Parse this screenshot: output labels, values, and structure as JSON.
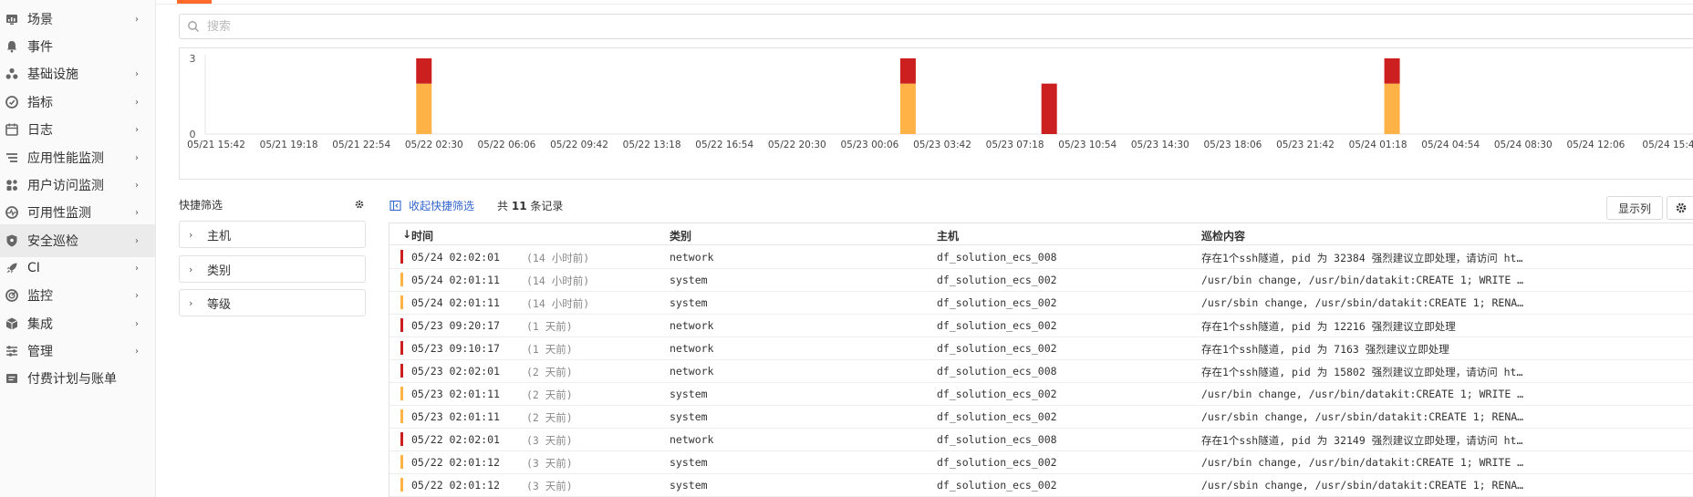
{
  "sidebar": {
    "items": [
      {
        "label": "场景",
        "icon": "dashboard-icon",
        "chevron": true
      },
      {
        "label": "事件",
        "icon": "bell-icon",
        "chevron": false
      },
      {
        "label": "基础设施",
        "icon": "infrastructure-icon",
        "chevron": true
      },
      {
        "label": "指标",
        "icon": "metrics-icon",
        "chevron": true
      },
      {
        "label": "日志",
        "icon": "log-icon",
        "chevron": true
      },
      {
        "label": "应用性能监测",
        "icon": "apm-icon",
        "chevron": true
      },
      {
        "label": "用户访问监测",
        "icon": "rum-icon",
        "chevron": true
      },
      {
        "label": "可用性监测",
        "icon": "availability-icon",
        "chevron": true
      },
      {
        "label": "安全巡检",
        "icon": "shield-icon",
        "chevron": true,
        "active": true
      },
      {
        "label": "CI",
        "icon": "rocket-icon",
        "chevron": true
      },
      {
        "label": "监控",
        "icon": "monitor-icon",
        "chevron": true
      },
      {
        "label": "集成",
        "icon": "integration-icon",
        "chevron": true
      },
      {
        "label": "管理",
        "icon": "settings-sliders-icon",
        "chevron": true
      },
      {
        "label": "付费计划与账单",
        "icon": "billing-icon",
        "chevron": false
      }
    ]
  },
  "search": {
    "placeholder": "搜索"
  },
  "colors": {
    "critical": "#cc1f1f",
    "warning": "#ffb347",
    "accent": "#ff6a2a",
    "link": "#3366cc"
  },
  "chart_data": {
    "type": "bar",
    "stacked": true,
    "ylim": [
      0,
      3
    ],
    "y_ticks": [
      "3",
      "0"
    ],
    "x_labels": [
      "05/21 15:42",
      "05/21 19:18",
      "05/21 22:54",
      "05/22 02:30",
      "05/22 06:06",
      "05/22 09:42",
      "05/22 13:18",
      "05/22 16:54",
      "05/22 20:30",
      "05/23 00:06",
      "05/23 03:42",
      "05/23 07:18",
      "05/23 10:54",
      "05/23 14:30",
      "05/23 18:06",
      "05/23 21:42",
      "05/24 01:18",
      "05/24 04:54",
      "05/24 08:30",
      "05/24 12:06",
      "05/24 15:4"
    ],
    "bars": [
      {
        "x": "05/22 02:00",
        "warning": 2,
        "critical": 1
      },
      {
        "x": "05/23 02:00",
        "warning": 2,
        "critical": 1
      },
      {
        "x": "05/23 09:00",
        "warning": 0,
        "critical": 2
      },
      {
        "x": "05/24 02:00",
        "warning": 2,
        "critical": 1
      }
    ]
  },
  "quick_filter": {
    "title": "快捷筛选",
    "items": [
      "主机",
      "类别",
      "等级"
    ]
  },
  "toolbar": {
    "collapse_label": "收起快捷筛选",
    "count_prefix": "共",
    "count": "11",
    "count_suffix": "条记录",
    "columns_label": "显示列"
  },
  "table": {
    "headers": [
      "时间",
      "类别",
      "主机",
      "巡检内容"
    ],
    "sort_indicator": "↓",
    "rows": [
      {
        "level": "critical",
        "time": "05/24 02:02:01",
        "rel": "(14 小时前)",
        "category": "network",
        "host": "df_solution_ecs_008",
        "content": "存在1个ssh隧道, pid 为 32384 强烈建议立即处理，请访问 ht…"
      },
      {
        "level": "warning",
        "time": "05/24 02:01:11",
        "rel": "(14 小时前)",
        "category": "system",
        "host": "df_solution_ecs_002",
        "content": "/usr/bin change, /usr/bin/datakit:CREATE 1; WRITE …"
      },
      {
        "level": "warning",
        "time": "05/24 02:01:11",
        "rel": "(14 小时前)",
        "category": "system",
        "host": "df_solution_ecs_002",
        "content": "/usr/sbin change, /usr/sbin/datakit:CREATE 1; RENA…"
      },
      {
        "level": "critical",
        "time": "05/23 09:20:17",
        "rel": "(1 天前)",
        "category": "network",
        "host": "df_solution_ecs_002",
        "content": "存在1个ssh隧道, pid 为 12216 强烈建议立即处理"
      },
      {
        "level": "critical",
        "time": "05/23 09:10:17",
        "rel": "(1 天前)",
        "category": "network",
        "host": "df_solution_ecs_002",
        "content": "存在1个ssh隧道, pid 为 7163 强烈建议立即处理"
      },
      {
        "level": "critical",
        "time": "05/23 02:02:01",
        "rel": "(2 天前)",
        "category": "network",
        "host": "df_solution_ecs_008",
        "content": "存在1个ssh隧道, pid 为 15802 强烈建议立即处理，请访问 ht…"
      },
      {
        "level": "warning",
        "time": "05/23 02:01:11",
        "rel": "(2 天前)",
        "category": "system",
        "host": "df_solution_ecs_002",
        "content": "/usr/bin change, /usr/bin/datakit:CREATE 1; WRITE …"
      },
      {
        "level": "warning",
        "time": "05/23 02:01:11",
        "rel": "(2 天前)",
        "category": "system",
        "host": "df_solution_ecs_002",
        "content": "/usr/sbin change, /usr/sbin/datakit:CREATE 1; RENA…"
      },
      {
        "level": "critical",
        "time": "05/22 02:02:01",
        "rel": "(3 天前)",
        "category": "network",
        "host": "df_solution_ecs_008",
        "content": "存在1个ssh隧道, pid 为 32149 强烈建议立即处理，请访问 ht…"
      },
      {
        "level": "warning",
        "time": "05/22 02:01:12",
        "rel": "(3 天前)",
        "category": "system",
        "host": "df_solution_ecs_002",
        "content": "/usr/bin change, /usr/bin/datakit:CREATE 1; WRITE …"
      },
      {
        "level": "warning",
        "time": "05/22 02:01:12",
        "rel": "(3 天前)",
        "category": "system",
        "host": "df_solution_ecs_002",
        "content": "/usr/sbin change, /usr/sbin/datakit:CREATE 1; RENA…"
      }
    ]
  }
}
